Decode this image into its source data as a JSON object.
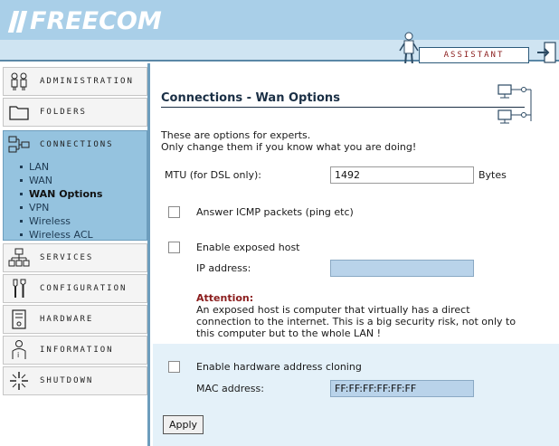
{
  "brand": {
    "logo_text": "FREECOM"
  },
  "header": {
    "assistant_label": "ASSISTANT"
  },
  "sidebar": {
    "items": [
      {
        "label": "ADMINISTRATION",
        "icon": "users-icon"
      },
      {
        "label": "FOLDERS",
        "icon": "folder-icon"
      },
      {
        "label": "CONNECTIONS",
        "icon": "network-icon"
      },
      {
        "label": "SERVICES",
        "icon": "services-icon"
      },
      {
        "label": "CONFIGURATION",
        "icon": "tools-icon"
      },
      {
        "label": "HARDWARE",
        "icon": "hardware-icon"
      },
      {
        "label": "INFORMATION",
        "icon": "info-person-icon"
      },
      {
        "label": "SHUTDOWN",
        "icon": "power-icon"
      }
    ],
    "sub_items": [
      "LAN",
      "WAN",
      "WAN Options",
      "VPN",
      "Wireless",
      "Wireless ACL"
    ],
    "current_sub": "WAN Options"
  },
  "page": {
    "title": "Connections - Wan Options",
    "intro_line1": "These are options for experts.",
    "intro_line2": "Only change them if you know what you are doing!"
  },
  "form": {
    "mtu_label": "MTU (for DSL only):",
    "mtu_value": "1492",
    "mtu_unit": "Bytes",
    "icmp_label": "Answer ICMP packets (ping etc)",
    "icmp_checked": false,
    "exposed_label": "Enable exposed host",
    "exposed_checked": false,
    "ip_label": "IP address:",
    "ip_value": "",
    "attention_title": "Attention:",
    "attention_text": "An exposed host is computer that virtually has a direct connection to the internet. This is a big security risk, not only to this computer but to the whole LAN !",
    "clone_label": "Enable hardware address cloning",
    "clone_checked": false,
    "mac_label": "MAC address:",
    "mac_value": "FF:FF:FF:FF:FF:FF",
    "apply_label": "Apply"
  },
  "colors": {
    "accent": "#a9cfe8",
    "active_nav": "#95c3df",
    "attention": "#8b1d1d"
  }
}
